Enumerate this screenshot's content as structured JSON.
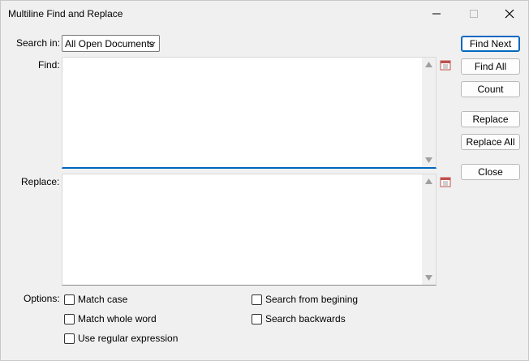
{
  "window": {
    "title": "Multiline Find and Replace"
  },
  "search_in": {
    "label": "Search in:",
    "selected": "All Open Documents"
  },
  "find": {
    "label": "Find:",
    "value": ""
  },
  "replace": {
    "label": "Replace:",
    "value": ""
  },
  "buttons": {
    "find_next": "Find Next",
    "find_all": "Find All",
    "count": "Count",
    "replace": "Replace",
    "replace_all": "Replace All",
    "close": "Close"
  },
  "options": {
    "label": "Options:",
    "match_case": "Match case",
    "match_whole_word": "Match whole word",
    "use_regex": "Use regular expression",
    "search_from_beginning": "Search from begining",
    "search_backwards": "Search backwards"
  },
  "colors": {
    "accent": "#0067c0",
    "background": "#f0f0f0"
  }
}
